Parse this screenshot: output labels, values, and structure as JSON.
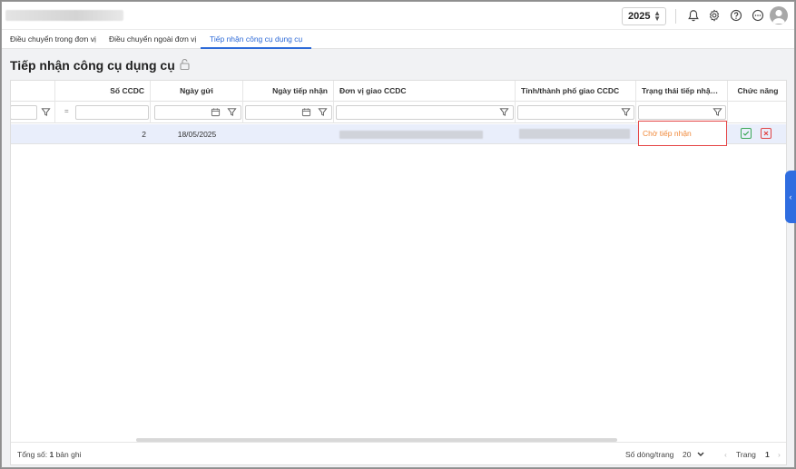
{
  "header": {
    "year": "2025",
    "icons": [
      "bell-icon",
      "gear-icon",
      "help-icon",
      "more-icon",
      "user-avatar"
    ]
  },
  "tabs": [
    {
      "label": "Điều chuyển trong đơn vị",
      "active": false
    },
    {
      "label": "Điều chuyển ngoài đơn vị",
      "active": false
    },
    {
      "label": "Tiếp nhận công cụ dụng cụ",
      "active": true
    }
  ],
  "page": {
    "title": "Tiếp nhận công cụ dụng cụ",
    "title_icon": "unlock-icon"
  },
  "table": {
    "columns": [
      "",
      "Số CCDC",
      "Ngày gửi",
      "Ngày tiếp nhận",
      "Đơn vị giao CCDC",
      "Tỉnh/thành phố giao CCDC",
      "Trạng thái tiếp nhận/...",
      "Chức năng"
    ],
    "filter": {
      "number_operator": "="
    },
    "rows": [
      {
        "so_ccdc": "2",
        "ngay_gui": "18/05/2025",
        "ngay_tiep_nhan": "",
        "trang_thai": "Chờ tiếp nhận"
      }
    ]
  },
  "footer": {
    "total_label": "Tổng số:",
    "total_value": "1",
    "total_unit": "bản ghi",
    "page_size_label": "Số dòng/trang",
    "page_size_value": "20",
    "page_label": "Trang",
    "page_value": "1"
  },
  "colors": {
    "accent": "#2d6ad8",
    "status_pending": "#f08a3c",
    "highlight_border": "#e54545",
    "selected_row": "#e9eefb"
  }
}
